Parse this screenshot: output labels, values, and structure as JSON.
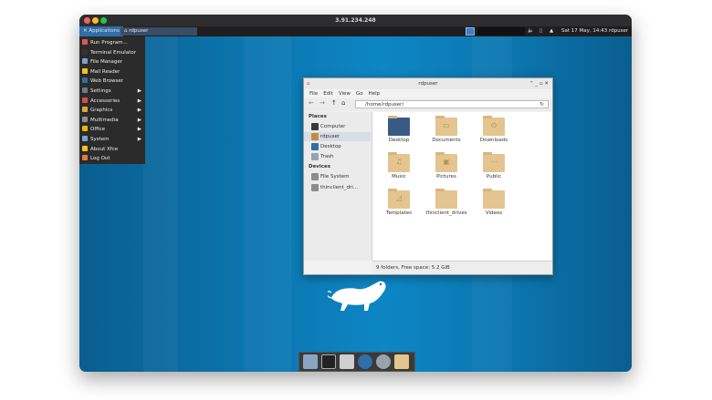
{
  "window": {
    "title": "3.91.234.248"
  },
  "panel": {
    "applications_label": "Applications",
    "task_label": "rdpuser",
    "datetime": "Sat 17 May, 14:43",
    "user": "rdpuser"
  },
  "menu": {
    "items": [
      {
        "label": "Run Program...",
        "icon": "run-icon",
        "submenu": false
      },
      {
        "label": "Terminal Emulator",
        "icon": "terminal-icon",
        "submenu": false
      },
      {
        "label": "File Manager",
        "icon": "file-manager-icon",
        "submenu": false
      },
      {
        "label": "Mail Reader",
        "icon": "mail-icon",
        "submenu": false
      },
      {
        "label": "Web Browser",
        "icon": "globe-icon",
        "submenu": false
      },
      {
        "label": "Settings",
        "icon": "settings-icon",
        "submenu": true
      },
      {
        "label": "Accessories",
        "icon": "accessories-icon",
        "submenu": true
      },
      {
        "label": "Graphics",
        "icon": "graphics-icon",
        "submenu": true
      },
      {
        "label": "Multimedia",
        "icon": "multimedia-icon",
        "submenu": true
      },
      {
        "label": "Office",
        "icon": "office-icon",
        "submenu": true
      },
      {
        "label": "System",
        "icon": "system-icon",
        "submenu": true
      },
      {
        "label": "About Xfce",
        "icon": "about-icon",
        "submenu": false
      },
      {
        "label": "Log Out",
        "icon": "logout-icon",
        "submenu": false
      }
    ]
  },
  "file_manager": {
    "title": "rdpuser",
    "menubar": [
      "File",
      "Edit",
      "View",
      "Go",
      "Help"
    ],
    "path": "/home/rdpuser/",
    "places_header": "Places",
    "places": [
      "Computer",
      "rdpuser",
      "Desktop",
      "Trash"
    ],
    "devices_header": "Devices",
    "devices": [
      "File System",
      "thinclient_dri..."
    ],
    "folders": [
      "Desktop",
      "Documents",
      "Downloads",
      "Music",
      "Pictures",
      "Public",
      "Templates",
      "thinclient_drives",
      "Videos"
    ],
    "status": "9 folders, Free space: 5.2 GiB"
  },
  "colors": {
    "accent": "#2f6fa8",
    "desktop": "#0b74ad",
    "folder": "#e4c590"
  }
}
